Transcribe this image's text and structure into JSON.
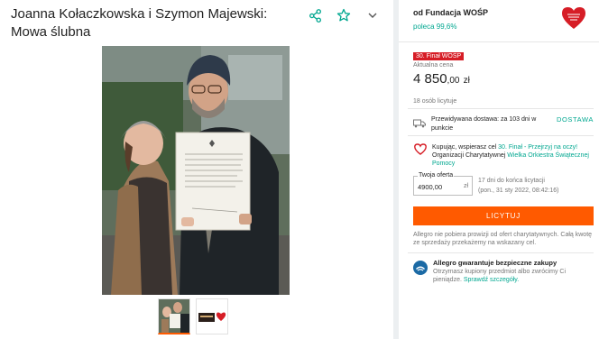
{
  "product": {
    "title": "Joanna Kołaczkowska i Szymon Majewski: Mowa ślubna",
    "actions": {
      "share_icon": "share-icon",
      "star_icon": "star-icon",
      "chevron_icon": "chevron-down-icon"
    }
  },
  "seller": {
    "name": "od Fundacja WOŚP",
    "rating": "poleca 99,6%",
    "logo_text": "wielka orkiestra świątecznej pomocy"
  },
  "offer": {
    "final_badge": "30. Finał WOŚP",
    "price_label": "Aktualna cena",
    "price_whole": "4 850",
    "price_cents": ",00",
    "price_currency": "zł",
    "bidders": "18 osób licytuje",
    "delivery_text": "Przewidywana dostawa: za 103 dni w punkcie",
    "delivery_link": "DOSTAWA",
    "charity_prefix": "Kupując, wspierasz cel ",
    "charity_goal": "30. Finał - Przejrzyj na oczy!",
    "charity_org_prefix": " Organizacji Charytatywnej ",
    "charity_org": "Wielka Orkiestra Świątecznej Pomocy",
    "bid_label": "Twoja oferta",
    "bid_value": "4900,00",
    "bid_unit": "zł",
    "ends_line1": "17 dni do końca licytacji",
    "ends_line2": "(pon., 31 sty 2022, 08:42:16)",
    "bid_button": "LICYTUJ",
    "fee_note": "Allegro nie pobiera prowizji od ofert charytatywnych. Całą kwotę ze sprzedaży przekażemy na wskazany cel.",
    "guarantee_title": "Allegro gwarantuje bezpieczne zakupy",
    "guarantee_text": "Otrzymasz kupiony przedmiot albo zwrócimy Ci pieniądze. ",
    "guarantee_link": "Sprawdź szczegóły."
  },
  "colors": {
    "accent": "#00a790",
    "cta": "#ff5a00",
    "badge": "#d61d26"
  }
}
